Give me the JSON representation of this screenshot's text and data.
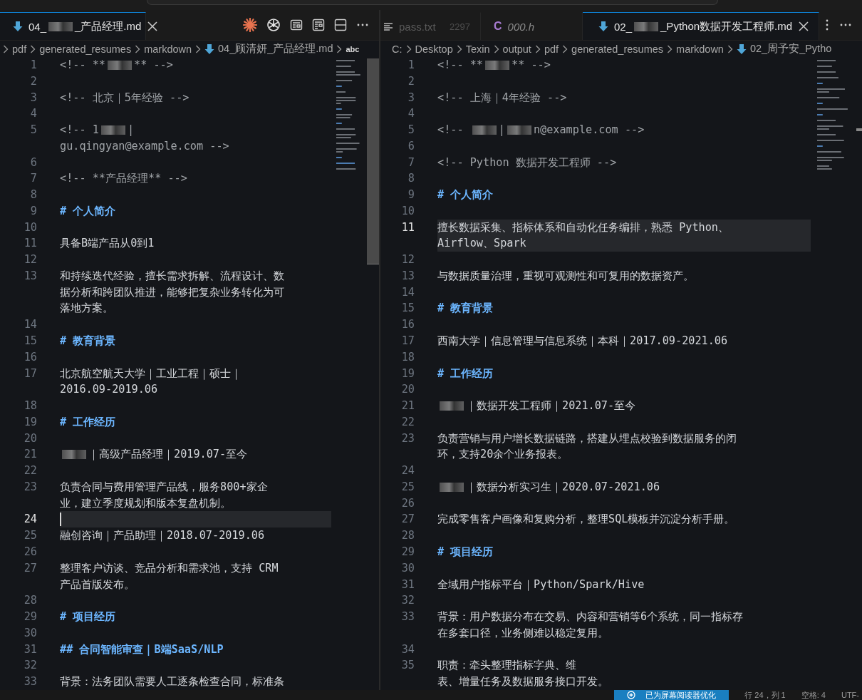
{
  "editors": [
    {
      "tabs": [
        {
          "kind": "markdown",
          "label_parts": [
            "04_",
            {
              "kind": "redaction"
            },
            "_产品经理.md"
          ],
          "selected": true,
          "closable": true
        }
      ],
      "breadcrumb": {
        "leading_separator": true,
        "items": [
          {
            "kind": "folder",
            "label": "pdf"
          },
          {
            "kind": "folder",
            "label": "generated_resumes"
          },
          {
            "kind": "folder",
            "label": "markdown"
          },
          {
            "kind": "file",
            "label": "04_顾清妍_产品经理.md"
          },
          {
            "kind": "symbol",
            "label": "abc"
          }
        ]
      },
      "lines": [
        {
          "n": "1",
          "kind": "comment",
          "current": false,
          "rows": [
            [
              "<!-- **",
              {
                "kind": "redaction"
              },
              "** -->"
            ]
          ]
        },
        {
          "n": "2",
          "kind": "blank",
          "current": false
        },
        {
          "n": "3",
          "kind": "comment",
          "current": false,
          "rows": [
            "<!-- 北京｜5年经验 -->"
          ]
        },
        {
          "n": "4",
          "kind": "blank",
          "current": false
        },
        {
          "n": "5",
          "kind": "comment",
          "current": false,
          "rows": [
            [
              "<!-- 1",
              {
                "kind": "redaction"
              },
              "|"
            ],
            "gu.qingyan@example.com -->"
          ]
        },
        {
          "n": "6",
          "kind": "blank",
          "current": false
        },
        {
          "n": "7",
          "kind": "comment",
          "current": false,
          "rows": [
            "<!-- **产品经理** -->"
          ]
        },
        {
          "n": "8",
          "kind": "blank",
          "current": false
        },
        {
          "n": "9",
          "kind": "heading",
          "current": false,
          "rows": [
            "# 个人简介"
          ]
        },
        {
          "n": "10",
          "kind": "blank",
          "current": false
        },
        {
          "n": "11",
          "kind": "text",
          "current": false,
          "rows": [
            "具备B端产品从0到1"
          ]
        },
        {
          "n": "12",
          "kind": "blank",
          "current": false
        },
        {
          "n": "13",
          "kind": "text",
          "current": false,
          "rows": [
            "和持续迭代经验，擅长需求拆解、流程设计、数",
            "据分析和跨团队推进，能够把复杂业务转化为可",
            "落地方案。"
          ]
        },
        {
          "n": "14",
          "kind": "blank",
          "current": false
        },
        {
          "n": "15",
          "kind": "heading",
          "current": false,
          "rows": [
            "# 教育背景"
          ]
        },
        {
          "n": "16",
          "kind": "blank",
          "current": false
        },
        {
          "n": "17",
          "kind": "text",
          "current": false,
          "rows": [
            "北京航空航天大学｜工业工程｜硕士｜",
            "2016.09-2019.06"
          ]
        },
        {
          "n": "18",
          "kind": "blank",
          "current": false
        },
        {
          "n": "19",
          "kind": "heading",
          "current": false,
          "rows": [
            "# 工作经历"
          ]
        },
        {
          "n": "20",
          "kind": "blank",
          "current": false
        },
        {
          "n": "21",
          "kind": "text",
          "current": false,
          "rows": [
            [
              {
                "kind": "redaction"
              },
              "｜高级产品经理｜2019.07-至今"
            ]
          ]
        },
        {
          "n": "22",
          "kind": "blank",
          "current": false
        },
        {
          "n": "23",
          "kind": "text",
          "current": false,
          "rows": [
            "负责合同与费用管理产品线，服务800+家企",
            "业，建立季度规划和版本复盘机制。"
          ]
        },
        {
          "n": "24",
          "kind": "blank",
          "current": true
        },
        {
          "n": "25",
          "kind": "text",
          "current": false,
          "rows": [
            "融创咨询｜产品助理｜2018.07-2019.06"
          ]
        },
        {
          "n": "26",
          "kind": "blank",
          "current": false
        },
        {
          "n": "27",
          "kind": "text",
          "current": false,
          "rows": [
            "整理客户访谈、竞品分析和需求池，支持 CRM",
            "产品首版发布。"
          ]
        },
        {
          "n": "28",
          "kind": "blank",
          "current": false
        },
        {
          "n": "29",
          "kind": "heading",
          "current": false,
          "rows": [
            "# 项目经历"
          ]
        },
        {
          "n": "30",
          "kind": "blank",
          "current": false
        },
        {
          "n": "31",
          "kind": "heading",
          "current": false,
          "rows": [
            "## 合同智能审查｜B端SaaS/NLP"
          ]
        },
        {
          "n": "32",
          "kind": "blank",
          "current": false
        },
        {
          "n": "33",
          "kind": "text",
          "current": false,
          "rows": [
            "背景：法务团队需要人工逐条检查合同，标准条"
          ]
        }
      ]
    },
    {
      "tabs": [
        {
          "kind": "text",
          "label": "pass.txt",
          "detail": "2297",
          "selected": false
        },
        {
          "kind": "c",
          "icon_text": "C",
          "label": "000.h",
          "selected": false,
          "preview": true
        },
        {
          "kind": "markdown",
          "label_parts": [
            "02_",
            {
              "kind": "redaction"
            },
            "_Python数据开发工程师.md"
          ],
          "selected": true,
          "closable": true
        }
      ],
      "breadcrumb": {
        "items": [
          {
            "kind": "folder",
            "label": "C:"
          },
          {
            "kind": "folder",
            "label": "Desktop"
          },
          {
            "kind": "folder",
            "label": "Texin"
          },
          {
            "kind": "folder",
            "label": "output"
          },
          {
            "kind": "folder",
            "label": "pdf"
          },
          {
            "kind": "folder",
            "label": "generated_resumes"
          },
          {
            "kind": "folder",
            "label": "markdown"
          },
          {
            "kind": "file",
            "label": "02_周予安_Pytho"
          }
        ]
      },
      "lines": [
        {
          "n": "1",
          "kind": "comment",
          "current": false,
          "rows": [
            [
              "<!-- **",
              {
                "kind": "redaction"
              },
              "** -->"
            ]
          ]
        },
        {
          "n": "2",
          "kind": "blank",
          "current": false
        },
        {
          "n": "3",
          "kind": "comment",
          "current": false,
          "rows": [
            "<!-- 上海｜4年经验 -->"
          ]
        },
        {
          "n": "4",
          "kind": "blank",
          "current": false
        },
        {
          "n": "5",
          "kind": "comment",
          "current": false,
          "rows": [
            [
              "<!-- ",
              {
                "kind": "redaction"
              },
              "|",
              {
                "kind": "redaction"
              },
              "n@example.com -->"
            ]
          ]
        },
        {
          "n": "6",
          "kind": "blank",
          "current": false
        },
        {
          "n": "7",
          "kind": "comment",
          "current": false,
          "rows": [
            "<!-- Python 数据开发工程师 -->"
          ]
        },
        {
          "n": "8",
          "kind": "blank",
          "current": false
        },
        {
          "n": "9",
          "kind": "heading",
          "current": false,
          "rows": [
            "# 个人简介"
          ]
        },
        {
          "n": "10",
          "kind": "blank",
          "current": false
        },
        {
          "n": "11",
          "kind": "text",
          "current": true,
          "rows": [
            "擅长数据采集、指标体系和自动化任务编排，熟悉 Python、",
            "Airflow、Spark"
          ]
        },
        {
          "n": "12",
          "kind": "blank",
          "current": false
        },
        {
          "n": "13",
          "kind": "text",
          "current": false,
          "rows": [
            "与数据质量治理，重视可观测性和可复用的数据资产。"
          ]
        },
        {
          "n": "14",
          "kind": "blank",
          "current": false
        },
        {
          "n": "15",
          "kind": "heading",
          "current": false,
          "rows": [
            "# 教育背景"
          ]
        },
        {
          "n": "16",
          "kind": "blank",
          "current": false
        },
        {
          "n": "17",
          "kind": "text",
          "current": false,
          "rows": [
            "西南大学｜信息管理与信息系统｜本科｜2017.09-2021.06"
          ]
        },
        {
          "n": "18",
          "kind": "blank",
          "current": false
        },
        {
          "n": "19",
          "kind": "heading",
          "current": false,
          "rows": [
            "# 工作经历"
          ]
        },
        {
          "n": "20",
          "kind": "blank",
          "current": false
        },
        {
          "n": "21",
          "kind": "text",
          "current": false,
          "rows": [
            [
              {
                "kind": "redaction"
              },
              "｜数据开发工程师｜2021.07-至今"
            ]
          ]
        },
        {
          "n": "22",
          "kind": "blank",
          "current": false
        },
        {
          "n": "23",
          "kind": "text",
          "current": false,
          "rows": [
            "负责营销与用户增长数据链路，搭建从埋点校验到数据服务的闭",
            "环，支持20余个业务报表。"
          ]
        },
        {
          "n": "24",
          "kind": "blank",
          "current": false
        },
        {
          "n": "25",
          "kind": "text",
          "current": false,
          "rows": [
            [
              {
                "kind": "redaction"
              },
              "｜数据分析实习生｜2020.07-2021.06"
            ]
          ]
        },
        {
          "n": "26",
          "kind": "blank",
          "current": false
        },
        {
          "n": "27",
          "kind": "text",
          "current": false,
          "rows": [
            "完成零售客户画像和复购分析，整理SQL模板并沉淀分析手册。"
          ]
        },
        {
          "n": "28",
          "kind": "blank",
          "current": false
        },
        {
          "n": "29",
          "kind": "heading",
          "current": false,
          "rows": [
            "# 项目经历"
          ]
        },
        {
          "n": "30",
          "kind": "blank",
          "current": false
        },
        {
          "n": "31",
          "kind": "text",
          "current": false,
          "rows": [
            "全域用户指标平台｜Python/Spark/Hive"
          ]
        },
        {
          "n": "32",
          "kind": "blank",
          "current": false
        },
        {
          "n": "33",
          "kind": "text",
          "current": false,
          "rows": [
            "背景：用户数据分布在交易、内容和营销等6个系统，同一指标存",
            "在多套口径，业务侧难以稳定复用。"
          ]
        },
        {
          "n": "34",
          "kind": "blank",
          "current": false
        },
        {
          "n": "35",
          "kind": "text",
          "current": false,
          "rows": [
            "职责：牵头整理指标字典、维",
            "表、增量任务及数据服务接口开发。"
          ]
        }
      ]
    }
  ],
  "status_bar": {
    "items": [
      {
        "kind": "badge",
        "label": "已为屏幕阅读器优化"
      },
      {
        "kind": "plain",
        "label": "行 24，列 1"
      },
      {
        "kind": "plain",
        "label": "空格: 4"
      },
      {
        "kind": "plain",
        "label": "UTF-"
      }
    ]
  }
}
